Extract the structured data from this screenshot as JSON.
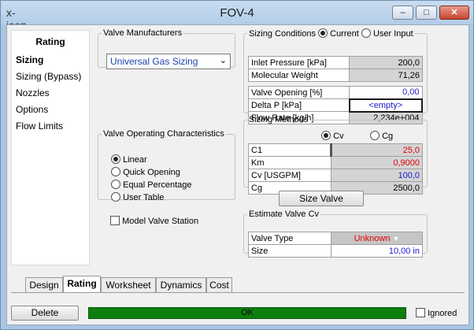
{
  "window": {
    "title": "FOV-4",
    "app_icon": "x-icon",
    "minimize": "–",
    "maximize": "□",
    "close": "✕"
  },
  "nav": {
    "header": "Rating",
    "items": [
      "Sizing",
      "Sizing (Bypass)",
      "Nozzles",
      "Options",
      "Flow Limits"
    ],
    "selected": "Sizing"
  },
  "manufacturers": {
    "legend": "Valve Manufacturers",
    "selected": "Universal Gas Sizing"
  },
  "operating": {
    "legend": "Valve Operating Characteristics",
    "options": [
      "Linear",
      "Quick Opening",
      "Equal Percentage",
      "User Table"
    ],
    "selected": "Linear"
  },
  "model_station": {
    "label": "Model Valve Station",
    "checked": false
  },
  "sizing_conditions": {
    "legend": "Sizing Conditions",
    "current_label": "Current",
    "user_input_label": "User Input",
    "selected": "Current",
    "rows1": [
      {
        "label": "Inlet Pressure [kPa]",
        "value": "200,0"
      },
      {
        "label": "Molecular Weight",
        "value": "71,26"
      }
    ],
    "rows2": [
      {
        "label": "Valve Opening [%]",
        "value": "0,00"
      },
      {
        "label": "Delta P [kPa]",
        "value": "<empty>"
      },
      {
        "label": "Flow Rate [kg/h]",
        "value": "2,234e+004"
      }
    ]
  },
  "sizing_methods": {
    "legend": "Sizing Methods",
    "cv_label": "Cv",
    "cg_label": "Cg",
    "selected": "Cv",
    "rows": [
      {
        "label": "C1",
        "value": "25,0"
      },
      {
        "label": "Km",
        "value": "0,9000"
      },
      {
        "label": "Cv [USGPM]",
        "value": "100,0"
      },
      {
        "label": "Cg",
        "value": "2500,0"
      }
    ]
  },
  "size_valve_button": "Size Valve",
  "estimate": {
    "legend": "Estimate Valve Cv",
    "rows": [
      {
        "label": "Valve Type",
        "value": "Unknown"
      },
      {
        "label": "Size",
        "value": "10,00 in"
      }
    ]
  },
  "tabs": [
    "Design",
    "Rating",
    "Worksheet",
    "Dynamics",
    "Cost"
  ],
  "active_tab": "Rating",
  "footer": {
    "delete_label": "Delete",
    "status_text": "OK",
    "ignored_label": "Ignored",
    "ignored_checked": false
  },
  "colors": {
    "status_bar": "#0e7e0e",
    "red_value": "#e00000",
    "blue_value": "#1a1ad0"
  }
}
